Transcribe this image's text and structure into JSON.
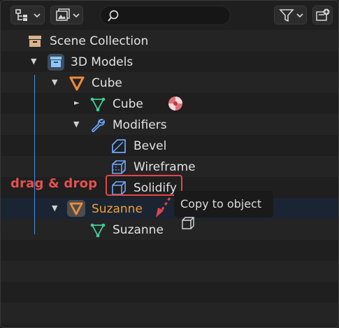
{
  "header": {
    "display_mode_icon": "outliner-display-icon",
    "view_layer_icon": "image-view-icon",
    "search_placeholder": "",
    "filter_icon": "funnel-filter-icon",
    "new_collection_icon": "new-collection-icon"
  },
  "tree": [
    {
      "label": "Scene Collection",
      "icon": "scene-collection-icon"
    },
    {
      "label": "3D Models",
      "icon": "collection-icon",
      "expanded": true
    },
    {
      "label": "Cube",
      "icon": "object-icon",
      "expanded": true
    },
    {
      "label": "Cube",
      "icon": "mesh-data-icon",
      "expanded": false,
      "material_icon": "material-icon"
    },
    {
      "label": "Modifiers",
      "icon": "wrench-icon",
      "expanded": true
    },
    {
      "label": "Bevel",
      "icon": "bevel-modifier-icon"
    },
    {
      "label": "Wireframe",
      "icon": "wireframe-modifier-icon"
    },
    {
      "label": "Solidify",
      "icon": "solidify-modifier-icon"
    },
    {
      "label": "Suzanne",
      "icon": "object-icon",
      "expanded": true,
      "selected": true
    },
    {
      "label": "Suzanne",
      "icon": "mesh-data-icon"
    }
  ],
  "annotation": {
    "drag_label": "drag & drop",
    "tooltip": "Copy to object"
  },
  "colors": {
    "background": "#1e1e1e",
    "row_alt": "#242424",
    "selected_row": "#1b2433",
    "selected_text": "#f0a030",
    "accent_red": "#e0454b",
    "object_orange": "#f08c3a",
    "mesh_green": "#3fcf9b",
    "modifier_blue": "#6fa8ff"
  }
}
